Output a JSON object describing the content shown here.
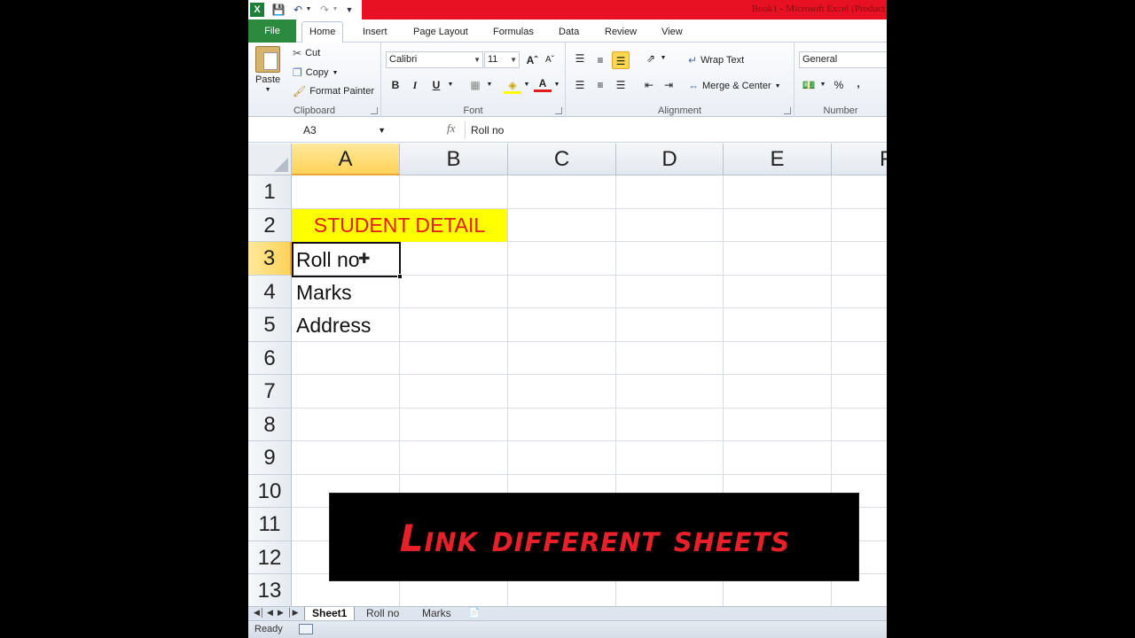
{
  "window": {
    "title": "Book1 - Microsoft Excel (Product"
  },
  "quick_access": {
    "icons": [
      "excel-logo-icon",
      "save-icon",
      "undo-icon",
      "redo-icon",
      "customize-icon"
    ]
  },
  "ribbon_tabs": [
    "File",
    "Home",
    "Insert",
    "Page Layout",
    "Formulas",
    "Data",
    "Review",
    "View"
  ],
  "active_ribbon_tab": "Home",
  "clipboard": {
    "paste": "Paste",
    "cut": "Cut",
    "copy": "Copy",
    "format_painter": "Format Painter",
    "label": "Clipboard"
  },
  "font": {
    "name": "Calibri",
    "size": "11",
    "bold": "B",
    "italic": "I",
    "underline": "U",
    "label": "Font"
  },
  "alignment": {
    "wrap_text": "Wrap Text",
    "merge_center": "Merge & Center",
    "label": "Alignment"
  },
  "number": {
    "format": "General",
    "percent": "%",
    "comma": ",",
    "label": "Number"
  },
  "formula_bar": {
    "name_box": "A3",
    "fx": "fx",
    "value": "Roll no"
  },
  "columns": [
    "A",
    "B",
    "C",
    "D",
    "E",
    "F"
  ],
  "selected_column": "A",
  "rows": [
    "1",
    "2",
    "3",
    "4",
    "5",
    "6",
    "7",
    "8",
    "9",
    "10",
    "11",
    "12",
    "13"
  ],
  "selected_row": "3",
  "cells": {
    "A2_B2": "STUDENT DETAIL",
    "A3": "Roll no",
    "A4": "Marks",
    "A5": "Address"
  },
  "colors": {
    "merged_fill": "#ffff00",
    "merged_text": "#e41b1b",
    "title_bar_accent": "#e81123",
    "file_tab": "#2b8a3e",
    "selection_header": "#ffd35a"
  },
  "sheet_tabs": [
    "Sheet1",
    "Roll no",
    "Marks"
  ],
  "active_sheet": "Sheet1",
  "status": {
    "ready": "Ready"
  },
  "overlay": {
    "caption": "Link different sheets"
  }
}
